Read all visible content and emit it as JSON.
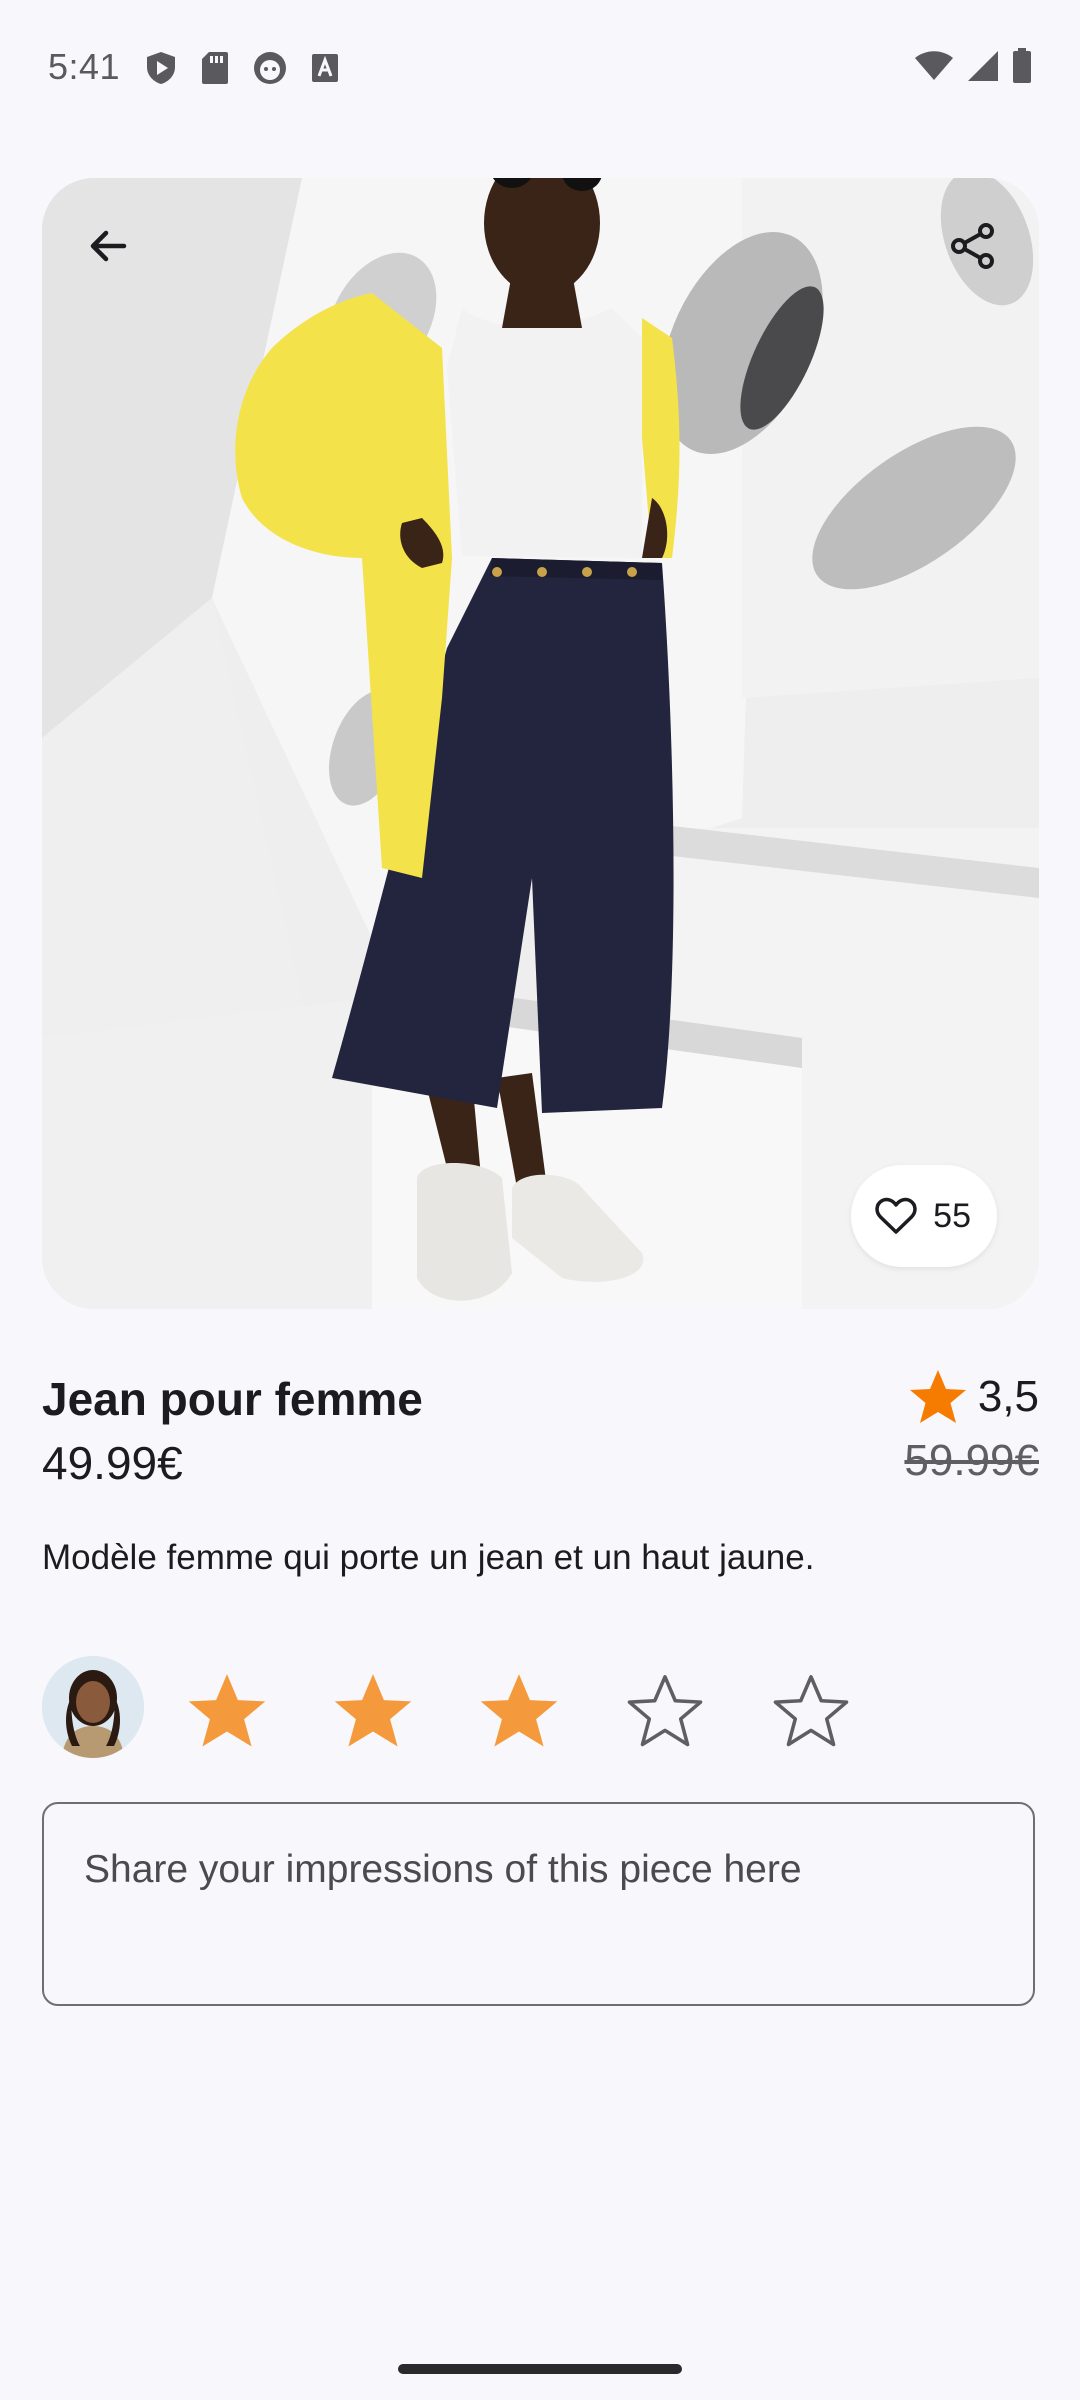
{
  "status_bar": {
    "time": "5:41",
    "left_icons": [
      "play-protect-icon",
      "sd-card-icon",
      "face-icon",
      "font-icon"
    ],
    "right_icons": [
      "wifi-icon",
      "signal-icon",
      "battery-icon"
    ]
  },
  "hero": {
    "image_icon": "product-photo",
    "back_icon": "arrow-back-icon",
    "share_icon": "share-icon",
    "like_count": "55"
  },
  "product": {
    "title": "Jean pour femme",
    "price": "49.99€",
    "old_price": "59.99€",
    "rating": "3,5",
    "description": "Modèle femme qui porte un jean et un haut jaune."
  },
  "user_rating": {
    "stars_selected": 3,
    "stars_total": 5
  },
  "comment": {
    "placeholder": "Share your impressions of this piece here",
    "value": ""
  },
  "colors": {
    "background": "#f8f7fc",
    "star_filled": "#f59a3c",
    "rating_star": "#f57c00",
    "text": "#1c1b1f"
  }
}
